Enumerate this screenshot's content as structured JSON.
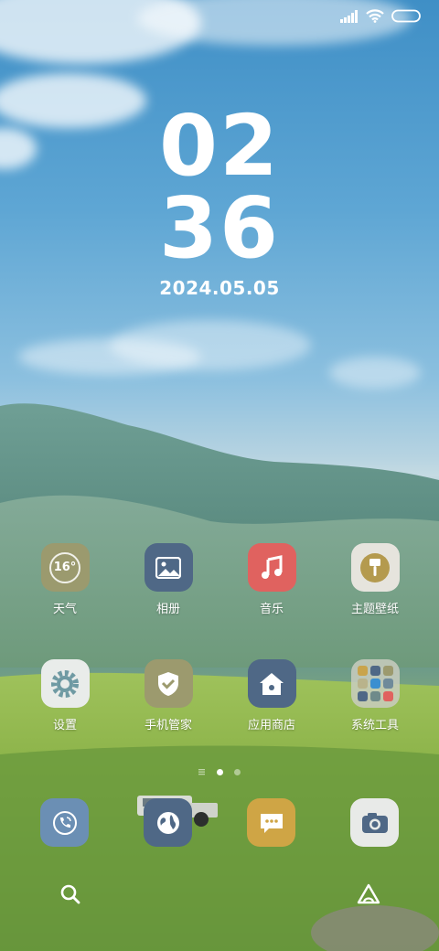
{
  "status_bar": {
    "signal_icon": "signal-icon",
    "wifi_icon": "wifi-icon",
    "battery_icon": "battery-icon"
  },
  "clock": {
    "hour": "02",
    "minute": "36"
  },
  "date": "2024.05.05",
  "apps_row1": [
    {
      "label": "天气",
      "icon": "weather-icon",
      "badge_text": "16°",
      "color": "#9b9a6e"
    },
    {
      "label": "相册",
      "icon": "gallery-icon",
      "color": "#4f6886"
    },
    {
      "label": "音乐",
      "icon": "music-icon",
      "color": "#e0625f"
    },
    {
      "label": "主题壁纸",
      "icon": "theme-icon",
      "color": "#e6e4dd"
    }
  ],
  "apps_row2": [
    {
      "label": "设置",
      "icon": "settings-icon",
      "color": "#e9ecea"
    },
    {
      "label": "手机管家",
      "icon": "security-icon",
      "color": "#9c9a6e"
    },
    {
      "label": "应用商店",
      "icon": "app-store-icon",
      "color": "#4f6886"
    },
    {
      "label": "系统工具",
      "icon": "folder-icon",
      "color": "#c9ccc0"
    }
  ],
  "page_indicator": {
    "pages": 3,
    "current": 1
  },
  "dock": [
    {
      "icon": "phone-icon",
      "color": "#6b8fb4"
    },
    {
      "icon": "browser-icon",
      "color": "#4f6886"
    },
    {
      "icon": "messages-icon",
      "color": "#cfa545"
    },
    {
      "icon": "camera-icon",
      "color": "#e8eae8"
    }
  ],
  "bottom": {
    "search_icon": "search-icon",
    "assistant_icon": "assistant-icon"
  }
}
